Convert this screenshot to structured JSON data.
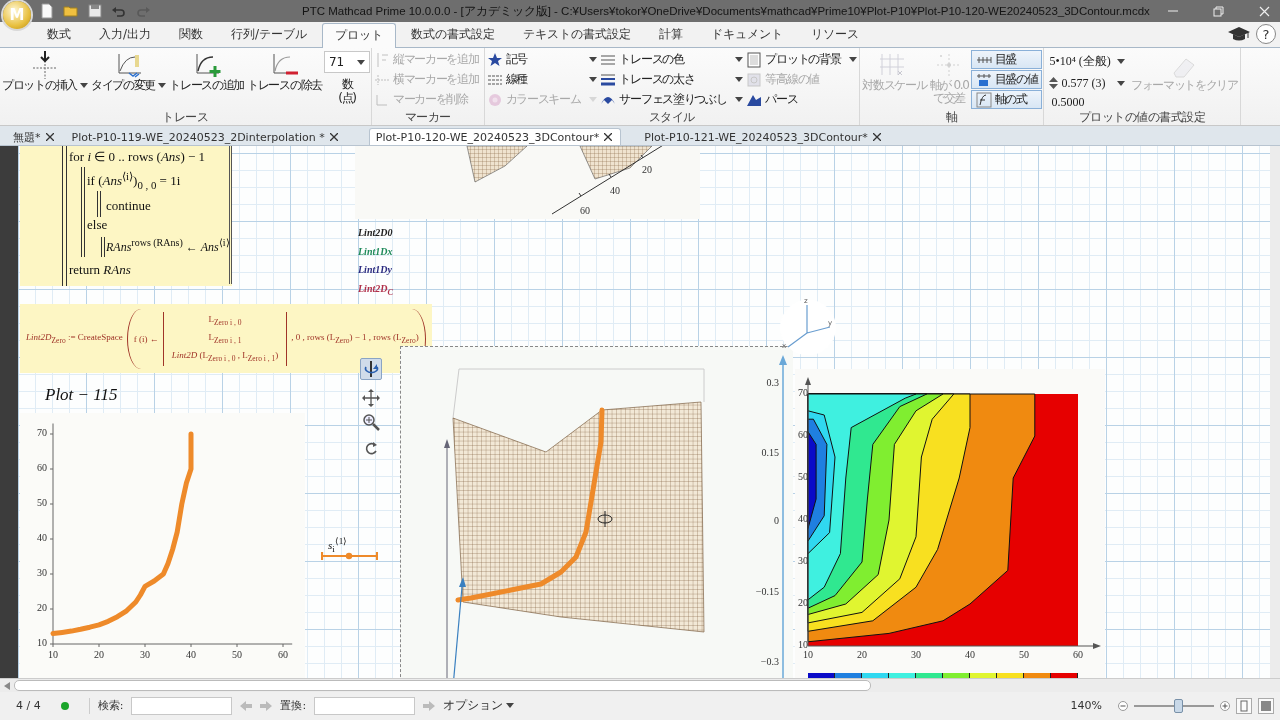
{
  "window": {
    "title": "PTC Mathcad Prime 10.0.0.0 - [アカデミック版] - C:¥Users¥tokor¥OneDrive¥Documents¥mathcad¥Prime10¥Plot-P10¥Plot-P10-120-WE20240523_3DContour.mcdx",
    "logo_letter": "M"
  },
  "quick_access": [
    {
      "disabled": false
    },
    {
      "disabled": false
    },
    {
      "disabled": false
    },
    {
      "disabled": false
    },
    {
      "disabled": true
    }
  ],
  "ribbon": {
    "tabs": [
      {
        "label": "数式",
        "selected": false
      },
      {
        "label": "入力/出力",
        "selected": false
      },
      {
        "label": "関数",
        "selected": false
      },
      {
        "label": "行列/テーブル",
        "selected": false
      },
      {
        "label": "プロット",
        "selected": true
      },
      {
        "label": "数式の書式設定",
        "selected": false
      },
      {
        "label": "テキストの書式設定",
        "selected": false
      },
      {
        "label": "計算",
        "selected": false
      },
      {
        "label": "ドキュメント",
        "selected": false
      },
      {
        "label": "リソース",
        "selected": false
      }
    ],
    "help": "?",
    "groups": [
      {
        "title": "トレース",
        "columns": [
          [
            {
              "kind": "large",
              "label": "プロットの挿入",
              "menu": true,
              "disabled": false
            }
          ],
          [
            {
              "kind": "large",
              "label": "タイプの変更",
              "menu": true,
              "disabled": false
            }
          ],
          [
            {
              "kind": "large",
              "label": "トレースの追加",
              "menu": false,
              "disabled": false
            }
          ],
          [
            {
              "kind": "large",
              "label": "トレースの除去",
              "menu": false,
              "disabled": false
            }
          ],
          [
            {
              "kind": "select",
              "value": "71",
              "menu": true,
              "disabled": false
            },
            {
              "kind": "caption",
              "label": "数\n(点)",
              "disabled": false
            }
          ]
        ]
      },
      {
        "title": "マーカー",
        "columns": [
          [
            {
              "kind": "small",
              "label": "縦マーカーを追加",
              "menu": false,
              "disabled": true
            },
            {
              "kind": "small",
              "label": "横マーカーを追加",
              "menu": false,
              "disabled": true
            },
            {
              "kind": "small",
              "label": "マーカーを削除",
              "menu": false,
              "disabled": true
            }
          ]
        ]
      },
      {
        "title": "スタイル",
        "columns": [
          [
            {
              "kind": "small",
              "label": "記号",
              "menu": true,
              "disabled": false
            },
            {
              "kind": "small",
              "label": "線種",
              "menu": true,
              "disabled": false
            },
            {
              "kind": "small",
              "label": "カラースキーム",
              "menu": true,
              "disabled": true
            }
          ],
          [
            {
              "kind": "small",
              "label": "トレースの色",
              "menu": true,
              "disabled": false
            },
            {
              "kind": "small",
              "label": "トレースの太さ",
              "menu": true,
              "disabled": false
            },
            {
              "kind": "small",
              "label": "サーフェス塗りつぶし",
              "menu": true,
              "disabled": false
            }
          ],
          [
            {
              "kind": "small",
              "label": "プロットの背景",
              "menu": true,
              "disabled": false
            },
            {
              "kind": "small",
              "label": "等高線の値",
              "menu": false,
              "disabled": true
            },
            {
              "kind": "small",
              "label": "パース",
              "menu": false,
              "disabled": false
            }
          ]
        ]
      },
      {
        "title": "軸",
        "columns": [
          [
            {
              "kind": "large",
              "label": "対数スケール",
              "menu": false,
              "disabled": true
            }
          ],
          [
            {
              "kind": "large",
              "label": "軸が 0.0\nで交差",
              "menu": false,
              "disabled": true
            }
          ],
          [
            {
              "kind": "toggle",
              "label": "目盛",
              "selected": true,
              "disabled": false
            },
            {
              "kind": "toggle",
              "label": "目盛の値",
              "selected": true,
              "disabled": false
            },
            {
              "kind": "toggle",
              "label": "軸の式",
              "selected": true,
              "disabled": false
            }
          ]
        ]
      },
      {
        "title": "プロットの値の書式設定",
        "columns": [
          [
            {
              "kind": "select",
              "value": "5•10⁴ (全般)",
              "menu": true,
              "disabled": false
            },
            {
              "kind": "spin-select",
              "value": "0.577 (3)",
              "menu": true,
              "disabled": false
            },
            {
              "kind": "caption",
              "label": "0.5000",
              "disabled": false
            }
          ],
          [
            {
              "kind": "large",
              "label": "フォーマットをクリア",
              "menu": false,
              "disabled": true
            }
          ]
        ]
      }
    ]
  },
  "document_tabs": [
    {
      "label": "無題*",
      "selected": false
    },
    {
      "label": "Plot-P10-119-WE_20240523_2Dinterpolation *",
      "selected": false
    },
    {
      "label": "Plot-P10-120-WE_20240523_3DContour*",
      "selected": true
    },
    {
      "label": "Plot-P10-121-WE_20240523_3DContour*",
      "selected": false
    }
  ],
  "worksheet": {
    "program_lines": [
      "for *i* ∈ 0 .. rows (*Ans*) − 1",
      "if (*Ans*$^{⟨i⟩}$)$_{0 , 0}$ = 1i",
      "continue",
      "else",
      "*RAns*$^{rows (RAns)}$ ← *Ans*$^{⟨i⟩}$",
      "return *RAns*"
    ],
    "top_plot_ticks": [
      "60",
      "40",
      "20"
    ],
    "legend": [
      {
        "label": "Lint2D0",
        "color": "#222222"
      },
      {
        "label": "Lint1Dx",
        "color": "#1f8a5a"
      },
      {
        "label": "Lint1Dy",
        "color": "#2c2c80"
      },
      {
        "label": "Lint2D$_{C}$",
        "color": "#b0304a"
      }
    ],
    "create_space": {
      "name": "*Lint2D*$_{Zero}$ := CreateSpace",
      "function": "f (i) ←",
      "matrix": [
        "L$_{Zero i , 0}$",
        "L$_{Zero i , 1}$",
        "*Lint2D* (L$_{Zero i , 0}$ , L$_{Zero i , 1}$)"
      ],
      "arguments": ", 0 , rows (L$_{Zero}$) − 1 , rows (L$_{Zero}$)"
    },
    "plot_tools": [
      {
        "selected": true
      },
      {
        "selected": false
      },
      {
        "selected": false
      },
      {
        "selected": false
      }
    ],
    "plot_115": {
      "title": "Plot − 115",
      "chart_data": {
        "type": "line",
        "x": [
          10,
          12,
          14,
          16,
          18,
          20,
          22,
          24,
          26,
          28,
          29,
          30,
          32,
          34,
          35,
          36,
          37,
          38,
          39,
          40,
          40,
          40
        ],
        "series": [
          {
            "name": "*s*$_{i}$$^{⟨1⟩}$",
            "color": "#ee8a2a",
            "values": [
              13,
              13.3,
              13.7,
              14.2,
              14.8,
              15.5,
              16.5,
              17.8,
              19.5,
              22,
              24,
              26.5,
              28,
              30,
              33,
              37,
              42,
              50,
              56,
              60,
              65,
              70
            ]
          }
        ],
        "xlim": [
          10,
          62
        ],
        "ylim": [
          10,
          73
        ],
        "xticks": [
          10,
          20,
          30,
          40,
          50,
          60
        ],
        "yticks": [
          10,
          20,
          30,
          40,
          50,
          60,
          70
        ]
      }
    },
    "plot_3d_ticks": [
      "0.3",
      "0.15",
      "0",
      "−0.15",
      "−0.3"
    ],
    "axis_triad": [
      "z",
      "y",
      "x"
    ],
    "contour": {
      "yticks": [
        "70",
        "60",
        "50",
        "40",
        "30",
        "20",
        "10"
      ],
      "xticks": [
        "10",
        "20",
        "30",
        "40",
        "50",
        "60"
      ],
      "colorbar": [
        {
          "color": "#0a0ac8"
        },
        {
          "color": "#1f7fe0"
        },
        {
          "color": "#30d8f0"
        },
        {
          "color": "#3ff0e0"
        },
        {
          "color": "#30e890"
        },
        {
          "color": "#80ee30"
        },
        {
          "color": "#e0f530"
        },
        {
          "color": "#f8e020"
        },
        {
          "color": "#f08a10"
        },
        {
          "color": "#e60000"
        }
      ]
    }
  },
  "status_bar": {
    "page": "4 / 4",
    "search_label": "検索:",
    "replace_label": "置換:",
    "options": "オプション",
    "zoom": "140%",
    "zoom_slider": {
      "level": 0.55
    }
  }
}
